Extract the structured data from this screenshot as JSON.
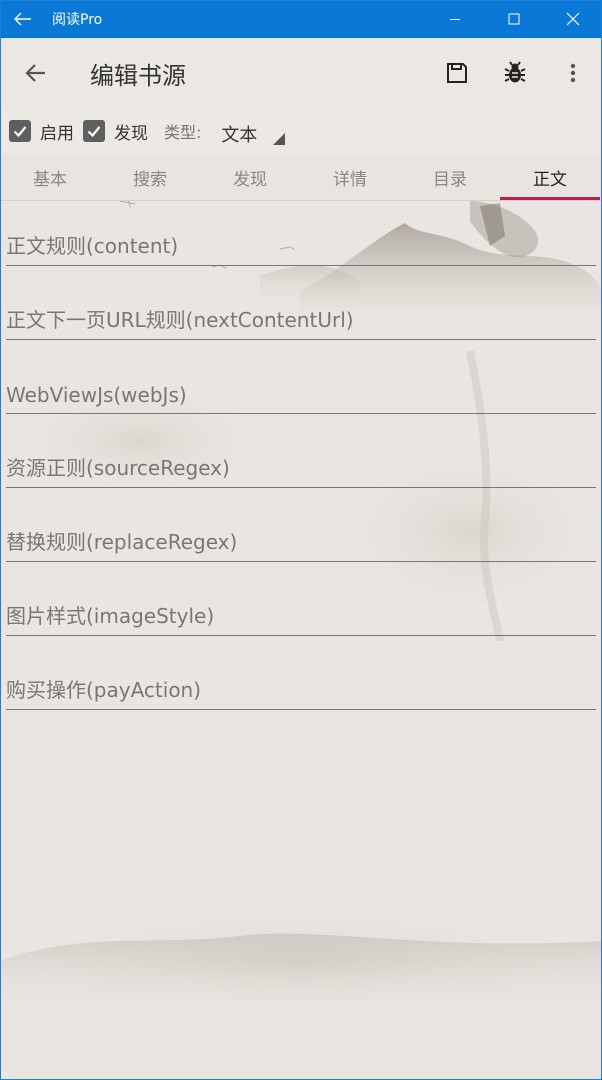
{
  "window": {
    "title": "阅读Pro"
  },
  "appbar": {
    "title": "编辑书源"
  },
  "options": {
    "enable_label": "启用",
    "discover_label": "发现",
    "type_label": "类型:",
    "type_value": "文本"
  },
  "tabs": [
    "基本",
    "搜索",
    "发现",
    "详情",
    "目录",
    "正文"
  ],
  "active_tab": "正文",
  "fields": [
    {
      "placeholder": "正文规则(content)"
    },
    {
      "placeholder": "正文下一页URL规则(nextContentUrl)"
    },
    {
      "placeholder": "WebViewJs(webJs)"
    },
    {
      "placeholder": "资源正则(sourceRegex)"
    },
    {
      "placeholder": "替换规则(replaceRegex)"
    },
    {
      "placeholder": "图片样式(imageStyle)"
    },
    {
      "placeholder": "购买操作(payAction)"
    }
  ],
  "colors": {
    "titlebar": "#0a78d7",
    "accent_tab_indicator": "#c2185b",
    "checkbox": "#5f5f5f"
  }
}
